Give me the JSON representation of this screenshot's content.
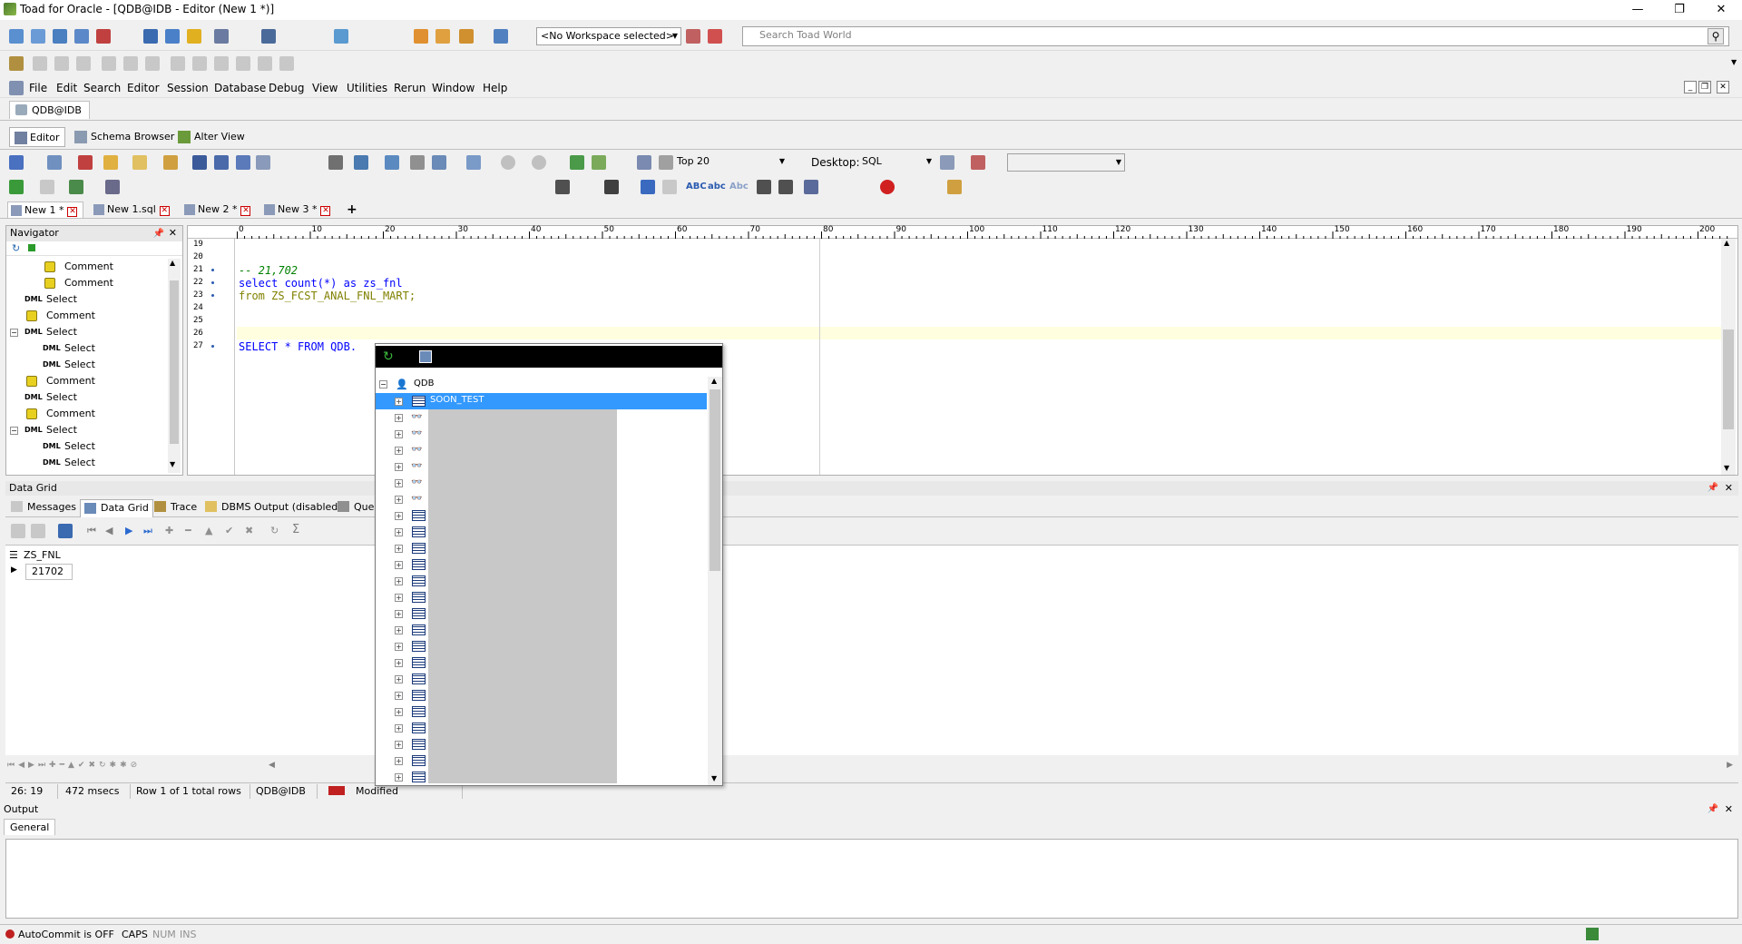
{
  "window": {
    "title": "Toad for Oracle - [QDB@IDB - Editor (New 1 *)]",
    "minimize": "—",
    "restore": "❐",
    "close": "✕"
  },
  "toolbar1": {
    "workspace": "<No Workspace selected>",
    "search_placeholder": "Search Toad World"
  },
  "menu": {
    "items": [
      "File",
      "Edit",
      "Search",
      "Editor",
      "Session",
      "Database",
      "Debug",
      "View",
      "Utilities",
      "Rerun",
      "Window",
      "Help"
    ]
  },
  "connection_tab": "QDB@IDB",
  "sub_tabs": [
    "Editor",
    "Schema Browser",
    "Alter View"
  ],
  "editor_toolbar": {
    "top_rows": "Top 20",
    "desktop_label": "Desktop:",
    "desktop_value": "SQL"
  },
  "doc_tabs": [
    {
      "label": "New 1 *"
    },
    {
      "label": "New 1.sql"
    },
    {
      "label": "New 2 *"
    },
    {
      "label": "New 3 *"
    }
  ],
  "doc_tab_add": "+",
  "navigator": {
    "title": "Navigator",
    "items": [
      {
        "indent": 2,
        "type": "comment",
        "label": "Comment"
      },
      {
        "indent": 2,
        "type": "comment",
        "label": "Comment"
      },
      {
        "indent": 1,
        "type": "dml",
        "label": "Select"
      },
      {
        "indent": 1,
        "type": "comment",
        "label": "Comment"
      },
      {
        "indent": 1,
        "type": "dml",
        "label": "Select",
        "expanded": true
      },
      {
        "indent": 2,
        "type": "dml",
        "label": "Select"
      },
      {
        "indent": 2,
        "type": "dml",
        "label": "Select"
      },
      {
        "indent": 1,
        "type": "comment",
        "label": "Comment"
      },
      {
        "indent": 1,
        "type": "dml",
        "label": "Select"
      },
      {
        "indent": 1,
        "type": "comment",
        "label": "Comment"
      },
      {
        "indent": 1,
        "type": "dml",
        "label": "Select",
        "expanded": true
      },
      {
        "indent": 2,
        "type": "dml",
        "label": "Select"
      },
      {
        "indent": 2,
        "type": "dml",
        "label": "Select"
      }
    ]
  },
  "ruler_labels": [
    "0",
    "10",
    "20",
    "30",
    "40",
    "50",
    "60",
    "70",
    "80",
    "90",
    "100",
    "110",
    "120",
    "130",
    "140",
    "150",
    "160",
    "170",
    "180",
    "190",
    "200"
  ],
  "editor": {
    "lines": [
      {
        "n": "19",
        "text": ""
      },
      {
        "n": "20",
        "text": ""
      },
      {
        "n": "21",
        "text": "-- 21,702"
      },
      {
        "n": "22",
        "text": "select count(*) as zs_fnl"
      },
      {
        "n": "23",
        "text": "from ZS_FCST_ANAL_FNL_MART;"
      },
      {
        "n": "24",
        "text": ""
      },
      {
        "n": "25",
        "text": ""
      },
      {
        "n": "26",
        "text": ""
      },
      {
        "n": "27",
        "text": "SELECT * FROM QDB."
      }
    ]
  },
  "code_insight": {
    "root": "QDB",
    "selected": "SOON_TEST",
    "row_kinds": [
      "table",
      "view",
      "view",
      "view",
      "view",
      "view",
      "view",
      "table",
      "table",
      "table",
      "table",
      "table",
      "table",
      "table",
      "table",
      "table",
      "table",
      "table",
      "table",
      "table",
      "table",
      "table",
      "table",
      "table"
    ]
  },
  "results": {
    "panel_title": "Data Grid",
    "tabs": [
      "Messages",
      "Data Grid",
      "Trace",
      "DBMS Output (disabled)",
      "Que"
    ],
    "column": "ZS_FNL",
    "value": "21702"
  },
  "status": {
    "position": "26: 19",
    "time": "472 msecs",
    "rows": "Row 1 of 1 total rows",
    "conn": "QDB@IDB",
    "state": "Modified"
  },
  "output": {
    "title": "Output",
    "tab": "General"
  },
  "bottom_status": {
    "autocommit": "AutoCommit is OFF",
    "caps": "CAPS",
    "num": "NUM",
    "ins": "INS"
  },
  "colors": {
    "selection": "#3399ff",
    "keyword": "#0000ff",
    "comment": "#008000",
    "current_line": "#ffffe0"
  }
}
